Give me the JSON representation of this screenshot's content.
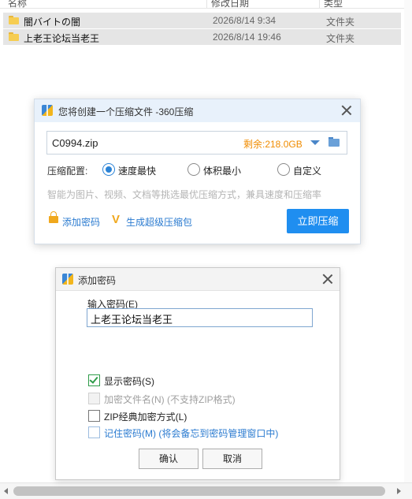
{
  "explorer": {
    "headers": [
      "名称",
      "修改日期",
      "类型"
    ],
    "files": [
      {
        "name": "闇バイトの闇",
        "date": "2026/8/14 9:34",
        "type": "文件夹"
      },
      {
        "name": "上老王论坛当老王",
        "date": "2026/8/14 19:46",
        "type": "文件夹"
      }
    ]
  },
  "compress_dialog": {
    "title": "您将创建一个压缩文件 -360压缩",
    "filename": "C0994.zip",
    "remaining": "剩余:218.0GB",
    "config_label": "压缩配置:",
    "options": [
      "速度最快",
      "体积最小",
      "自定义"
    ],
    "selected_option": "速度最快",
    "hint": "智能为图片、视频、文档等挑选最优压缩方式，兼具速度和压缩率",
    "add_password": "添加密码",
    "super_package": "生成超级压缩包",
    "compress_button": "立即压缩",
    "accent_color": "#1f8ef0",
    "icons": [
      "archive-app-icon",
      "close-icon",
      "dropdown-arrow-icon",
      "folder-icon",
      "lock-icon",
      "vip-icon"
    ]
  },
  "password_dialog": {
    "title": "添加密码",
    "input_label": "输入密码(E)",
    "password_value": "上老王论坛当老王",
    "show_password": {
      "label": "显示密码(S)",
      "checked": true
    },
    "encrypt_filenames": {
      "label": "加密文件名(N) (不支持ZIP格式)",
      "checked": false,
      "disabled": true
    },
    "zip_classic": {
      "label": "ZIP经典加密方式(L)",
      "checked": false
    },
    "remember": {
      "label": "记住密码(M) (将会备忘到密码管理窗口中)",
      "checked": false
    },
    "ok_button": "确认",
    "cancel_button": "取消"
  }
}
